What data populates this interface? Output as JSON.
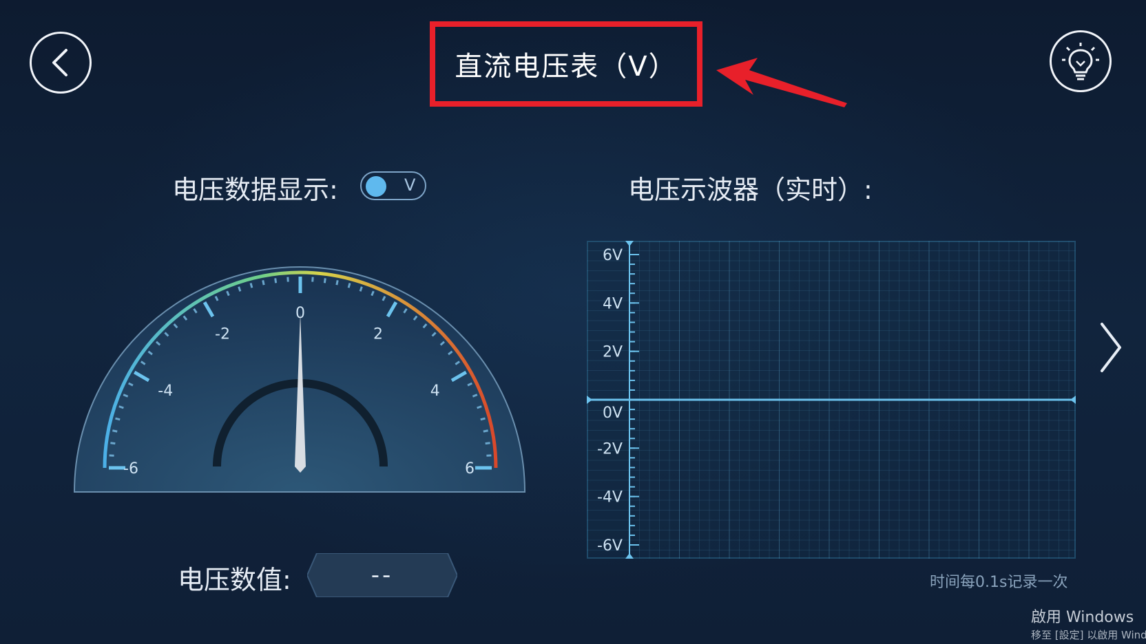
{
  "header": {
    "title": "直流电压表（V）",
    "back_icon": "chevron-left-icon",
    "hint_icon": "lightbulb-icon"
  },
  "left_panel": {
    "data_display_label": "电压数据显示:",
    "toggle_unit": "V",
    "toggle_on": true,
    "gauge": {
      "min": -6,
      "max": 6,
      "tick_labels": [
        "-6",
        "-4",
        "-2",
        "0",
        "2",
        "4",
        "6"
      ],
      "needle_value": 0
    },
    "voltage_value_label": "电压数值:",
    "voltage_value": "--"
  },
  "right_panel": {
    "oscilloscope_label": "电压示波器（实时）:",
    "footnote": "时间每0.1s记录一次",
    "next_icon": "chevron-right-icon"
  },
  "chart_data": {
    "type": "line",
    "title": "",
    "xlabel": "",
    "ylabel": "",
    "ylim": [
      -6,
      6
    ],
    "y_tick_labels": [
      "6V",
      "4V",
      "2V",
      "0V",
      "-2V",
      "-4V",
      "-6V"
    ],
    "y_ticks": [
      6,
      4,
      2,
      0,
      -2,
      -4,
      -6
    ],
    "grid": true,
    "series": [
      {
        "values": [
          0,
          0
        ]
      }
    ]
  },
  "colors": {
    "background": "#0f2038",
    "accent": "#5fb9ee",
    "highlight_border": "#e8202a",
    "gauge_hot": "#d9482b",
    "gauge_warm": "#d7d24a",
    "gauge_cool": "#4cb0e8"
  },
  "watermark": {
    "line1": "啟用 Windows",
    "line2": "移至 [設定] 以啟用 Wind"
  }
}
